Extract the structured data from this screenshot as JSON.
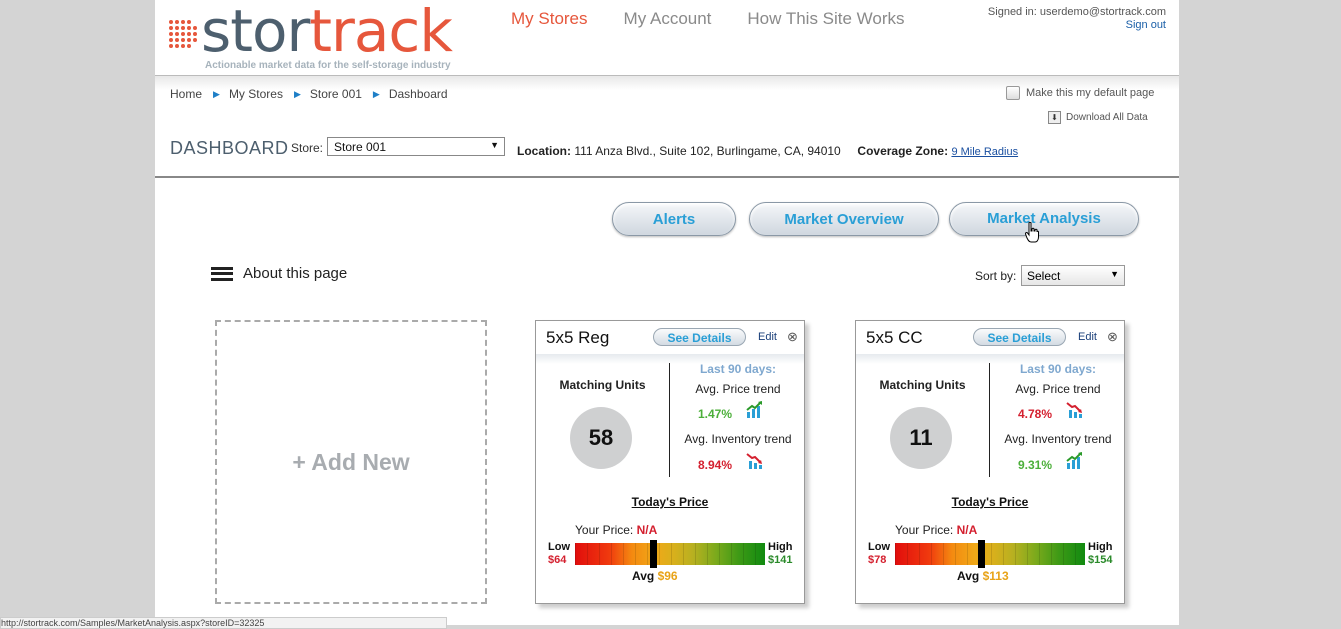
{
  "header": {
    "logo_part1": "stor",
    "logo_part2": "track",
    "tagline": "Actionable market data for the self-storage industry",
    "nav": [
      "My Stores",
      "My Account",
      "How This Site Works"
    ],
    "signed_in": "Signed in: userdemo@stortrack.com",
    "sign_out": "Sign out"
  },
  "breadcrumb": [
    "Home",
    "My Stores",
    "Store 001",
    "Dashboard"
  ],
  "default_page_label": "Make this my default page",
  "download_label": "Download All Data",
  "dashboard": {
    "title": "DASHBOARD",
    "store_label": "Store:",
    "store_value": "Store 001",
    "location_label": "Location:",
    "location_value": "111 Anza Blvd., Suite 102, Burlingame, CA, 94010",
    "coverage_label": "Coverage Zone:",
    "coverage_value": "9 Mile Radius"
  },
  "tabs": [
    "Alerts",
    "Market Overview",
    "Market Analysis"
  ],
  "about_label": "About this page",
  "sort": {
    "label": "Sort by:",
    "value": "Select"
  },
  "add_new": "+ Add New",
  "cards": [
    {
      "title": "5x5 Reg",
      "details": "See Details",
      "edit": "Edit",
      "matching_label": "Matching Units",
      "matching_units": "58",
      "last90": "Last 90 days:",
      "price_trend_label": "Avg. Price trend",
      "price_trend": "1.47%",
      "price_trend_dir": "up",
      "inventory_trend_label": "Avg. Inventory trend",
      "inventory_trend": "8.94%",
      "inventory_trend_dir": "down",
      "todays_price": "Today's Price",
      "your_price_label": "Your Price:",
      "your_price": "N/A",
      "low_label": "Low",
      "low": "$64",
      "high_label": "High",
      "high": "$141",
      "avg_label": "Avg",
      "avg": "$96"
    },
    {
      "title": "5x5 CC",
      "details": "See Details",
      "edit": "Edit",
      "matching_label": "Matching Units",
      "matching_units": "11",
      "last90": "Last 90 days:",
      "price_trend_label": "Avg. Price trend",
      "price_trend": "4.78%",
      "price_trend_dir": "down",
      "inventory_trend_label": "Avg. Inventory trend",
      "inventory_trend": "9.31%",
      "inventory_trend_dir": "up",
      "todays_price": "Today's Price",
      "your_price_label": "Your Price:",
      "your_price": "N/A",
      "low_label": "Low",
      "low": "$78",
      "high_label": "High",
      "high": "$154",
      "avg_label": "Avg",
      "avg": "$113"
    }
  ],
  "status_bar": "http://stortrack.com/Samples/MarketAnalysis.aspx?storeID=32325",
  "colors": {
    "accent": "#e6573c",
    "button_text": "#2a9fd6",
    "up": "#4caf3a",
    "down": "#d4202f"
  }
}
